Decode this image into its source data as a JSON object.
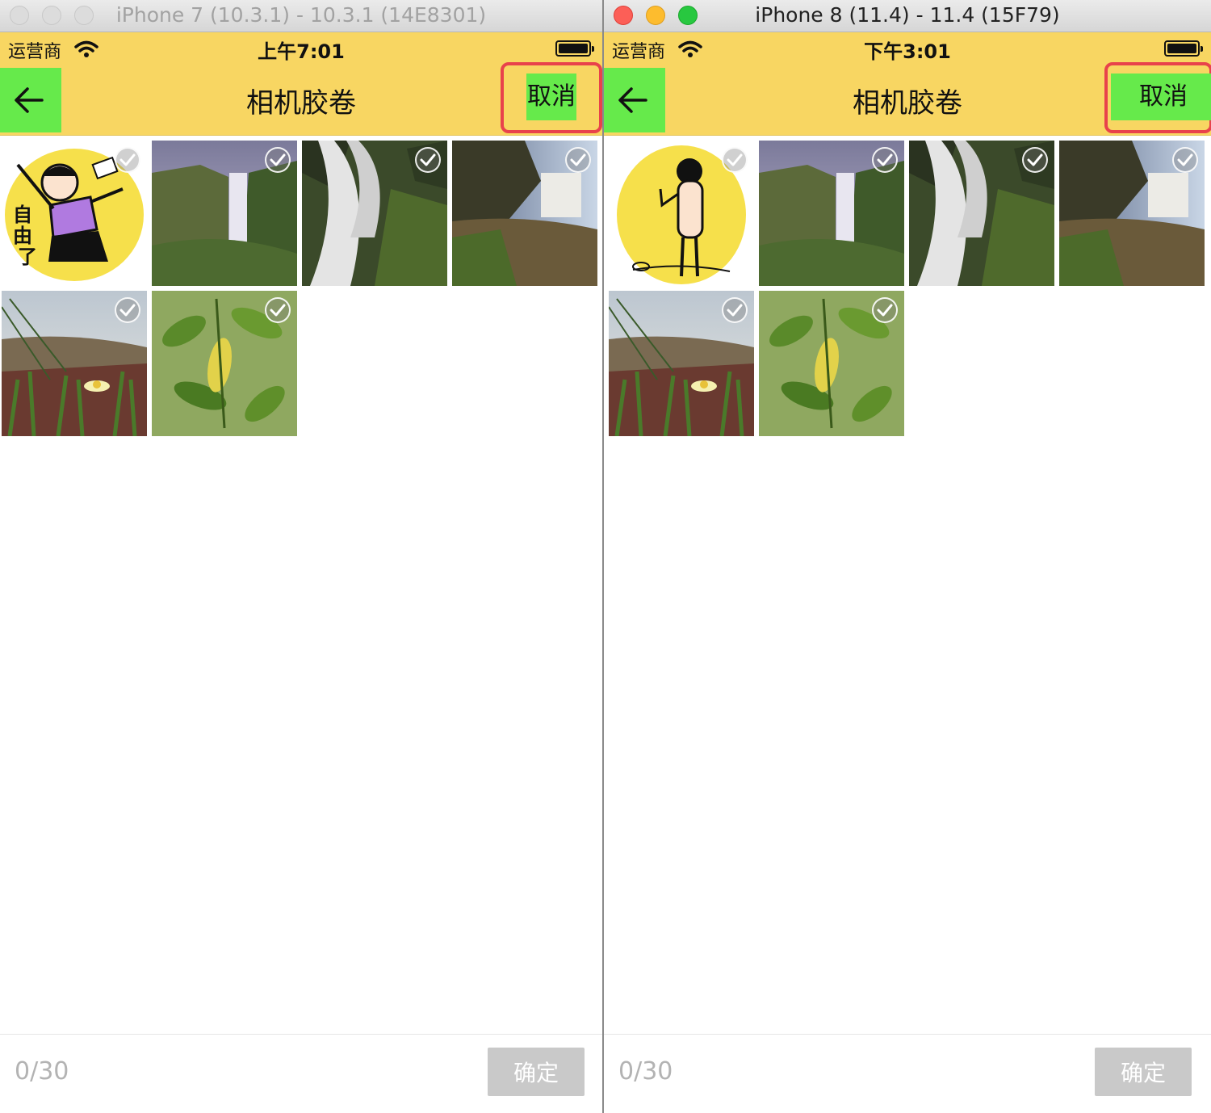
{
  "windows": [
    {
      "title": "iPhone 7 (10.3.1) - 10.3.1 (14E8301)",
      "status": {
        "carrier": "运营商",
        "time": "上午7:01"
      },
      "nav": {
        "title": "相机胶卷",
        "cancel": "取消"
      },
      "photos": [
        "sticker-girl-自由了",
        "waterfall-valley",
        "waterfall-closeup",
        "waterfall-cliff",
        "grass-flower",
        "green-leaves"
      ],
      "footer": {
        "count": "0/30",
        "confirm": "确定"
      }
    },
    {
      "title": "iPhone 8 (11.4) - 11.4 (15F79)",
      "status": {
        "carrier": "运营商",
        "time": "下午3:01"
      },
      "nav": {
        "title": "相机胶卷",
        "cancel": "取消"
      },
      "photos": [
        "sticker-boy-standing",
        "waterfall-valley",
        "waterfall-closeup",
        "waterfall-cliff",
        "grass-flower",
        "green-leaves"
      ],
      "footer": {
        "count": "0/30",
        "confirm": "确定"
      }
    }
  ],
  "colors": {
    "nav_background": "#f8d662",
    "highlight_green": "#66ea4b",
    "annotation_red": "#e8424b",
    "confirm_disabled": "#c9c9c9"
  },
  "icons": [
    "back-arrow-icon",
    "wifi-icon",
    "battery-icon",
    "select-check-icon"
  ]
}
